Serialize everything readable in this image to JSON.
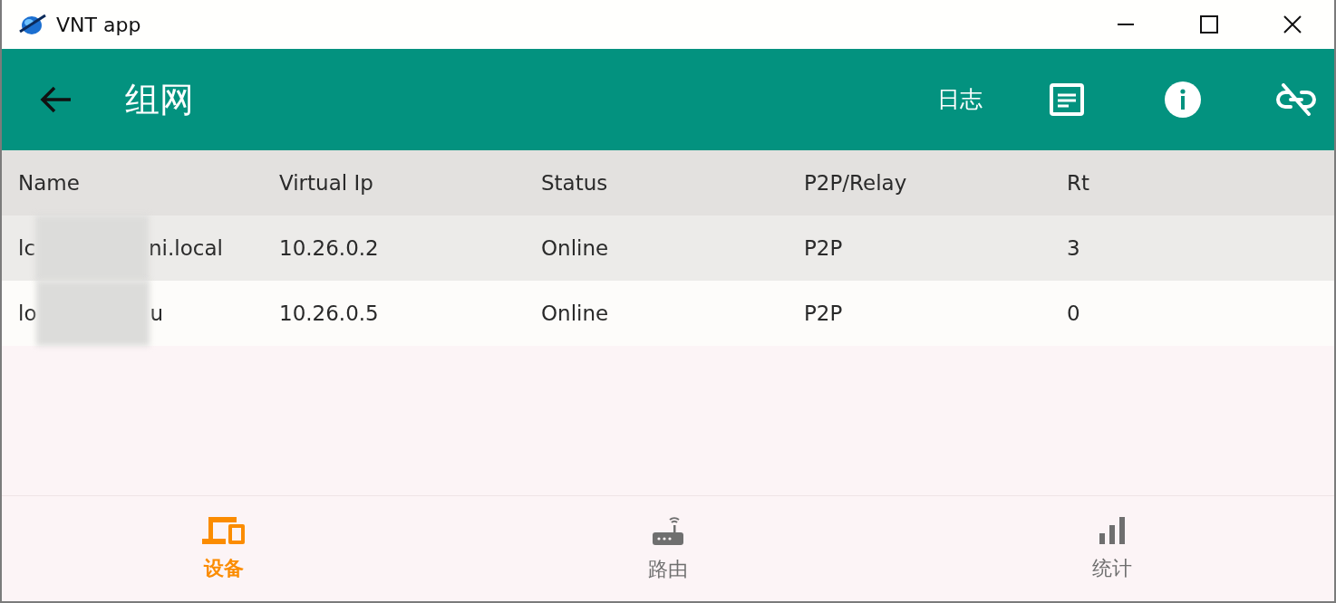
{
  "window": {
    "title": "VNT app"
  },
  "app_bar": {
    "title": "组网",
    "log_label": "日志"
  },
  "table": {
    "columns": [
      "Name",
      "Virtual Ip",
      "Status",
      "P2P/Relay",
      "Rt"
    ],
    "rows": [
      {
        "name_start": "lc",
        "name_redacted": true,
        "name_end": "ni.local",
        "virtual_ip": "10.26.0.2",
        "status": "Online",
        "mode": "P2P",
        "rt": "3",
        "shaded": true
      },
      {
        "name_start": "lo",
        "name_redacted": true,
        "name_end": "u",
        "virtual_ip": "10.26.0.5",
        "status": "Online",
        "mode": "P2P",
        "rt": "0",
        "shaded": false
      }
    ]
  },
  "bottom_nav": [
    {
      "label": "设备",
      "kind": "devices",
      "selected": true
    },
    {
      "label": "路由",
      "kind": "router",
      "selected": false
    },
    {
      "label": "统计",
      "kind": "stats",
      "selected": false
    }
  ]
}
